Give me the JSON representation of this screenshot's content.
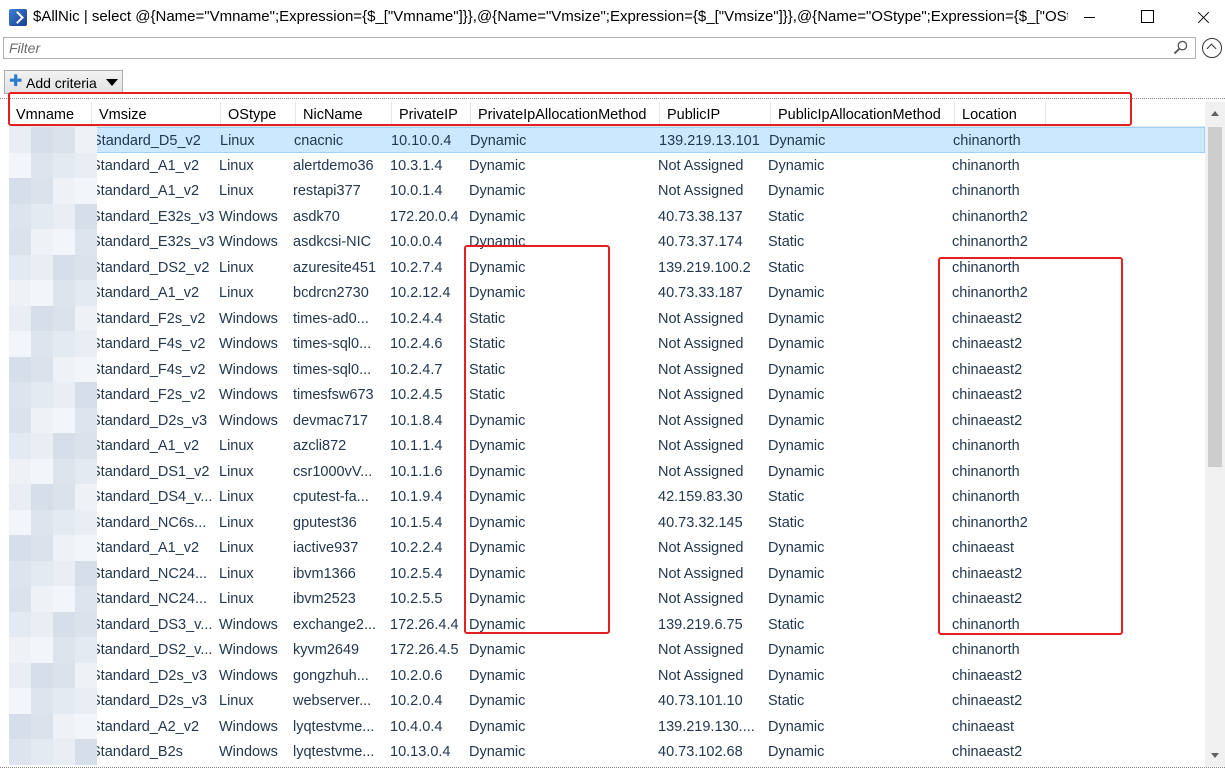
{
  "window": {
    "title": "$AllNic | select @{Name=\"Vmname\";Expression={$_[\"Vmname\"]}},@{Name=\"Vmsize\";Expression={$_[\"Vmsize\"]}},@{Name=\"OStype\";Expression={$_[\"OStype\"]}}..."
  },
  "filter": {
    "placeholder": "Filter"
  },
  "toolbar": {
    "add_criteria_label": "Add criteria"
  },
  "columns": [
    "Vmname",
    "Vmsize",
    "OStype",
    "NicName",
    "PrivateIP",
    "PrivateIpAllocationMethod",
    "PublicIP",
    "PublicIpAllocationMethod",
    "Location"
  ],
  "rows": [
    [
      "Standard_D5_v2",
      "Linux",
      "cnacnic",
      "10.10.0.4",
      "Dynamic",
      "139.219.13.101",
      "Dynamic",
      "chinanorth"
    ],
    [
      "Standard_A1_v2",
      "Linux",
      "alertdemo36",
      "10.3.1.4",
      "Dynamic",
      "Not Assigned",
      "Dynamic",
      "chinanorth"
    ],
    [
      "Standard_A1_v2",
      "Linux",
      "restapi377",
      "10.0.1.4",
      "Dynamic",
      "Not Assigned",
      "Dynamic",
      "chinanorth"
    ],
    [
      "Standard_E32s_v3",
      "Windows",
      "asdk70",
      "172.20.0.4",
      "Dynamic",
      "40.73.38.137",
      "Static",
      "chinanorth2"
    ],
    [
      "Standard_E32s_v3",
      "Windows",
      "asdkcsi-NIC",
      "10.0.0.4",
      "Dynamic",
      "40.73.37.174",
      "Static",
      "chinanorth2"
    ],
    [
      "Standard_DS2_v2",
      "Linux",
      "azuresite451",
      "10.2.7.4",
      "Dynamic",
      "139.219.100.2",
      "Static",
      "chinanorth"
    ],
    [
      "Standard_A1_v2",
      "Linux",
      "bcdrcn2730",
      "10.2.12.4",
      "Dynamic",
      "40.73.33.187",
      "Dynamic",
      "chinanorth2"
    ],
    [
      "Standard_F2s_v2",
      "Windows",
      "times-ad0...",
      "10.2.4.4",
      "Static",
      "Not Assigned",
      "Dynamic",
      "chinaeast2"
    ],
    [
      "Standard_F4s_v2",
      "Windows",
      "times-sql0...",
      "10.2.4.6",
      "Static",
      "Not Assigned",
      "Dynamic",
      "chinaeast2"
    ],
    [
      "Standard_F4s_v2",
      "Windows",
      "times-sql0...",
      "10.2.4.7",
      "Static",
      "Not Assigned",
      "Dynamic",
      "chinaeast2"
    ],
    [
      "Standard_F2s_v2",
      "Windows",
      "timesfsw673",
      "10.2.4.5",
      "Static",
      "Not Assigned",
      "Dynamic",
      "chinaeast2"
    ],
    [
      "Standard_D2s_v3",
      "Windows",
      "devmac717",
      "10.1.8.4",
      "Dynamic",
      "Not Assigned",
      "Dynamic",
      "chinaeast2"
    ],
    [
      "Standard_A1_v2",
      "Linux",
      "azcli872",
      "10.1.1.4",
      "Dynamic",
      "Not Assigned",
      "Dynamic",
      "chinanorth"
    ],
    [
      "Standard_DS1_v2",
      "Linux",
      "csr1000vV...",
      "10.1.1.6",
      "Dynamic",
      "Not Assigned",
      "Dynamic",
      "chinanorth"
    ],
    [
      "Standard_DS4_v...",
      "Linux",
      "cputest-fa...",
      "10.1.9.4",
      "Dynamic",
      "42.159.83.30",
      "Static",
      "chinanorth"
    ],
    [
      "Standard_NC6s...",
      "Linux",
      "gputest36",
      "10.1.5.4",
      "Dynamic",
      "40.73.32.145",
      "Static",
      "chinanorth2"
    ],
    [
      "Standard_A1_v2",
      "Linux",
      "iactive937",
      "10.2.2.4",
      "Dynamic",
      "Not Assigned",
      "Dynamic",
      "chinaeast"
    ],
    [
      "Standard_NC24...",
      "Linux",
      "ibvm1366",
      "10.2.5.4",
      "Dynamic",
      "Not Assigned",
      "Dynamic",
      "chinaeast2"
    ],
    [
      "Standard_NC24...",
      "Linux",
      "ibvm2523",
      "10.2.5.5",
      "Dynamic",
      "Not Assigned",
      "Dynamic",
      "chinaeast2"
    ],
    [
      "Standard_DS3_v...",
      "Windows",
      "exchange2...",
      "172.26.4.4",
      "Dynamic",
      "139.219.6.75",
      "Static",
      "chinanorth"
    ],
    [
      "Standard_DS2_v...",
      "Windows",
      "kyvm2649",
      "172.26.4.5",
      "Dynamic",
      "Not Assigned",
      "Dynamic",
      "chinanorth"
    ],
    [
      "Standard_D2s_v3",
      "Windows",
      "gongzhuh...",
      "10.2.0.6",
      "Dynamic",
      "Not Assigned",
      "Dynamic",
      "chinaeast2"
    ],
    [
      "Standard_D2s_v3",
      "Linux",
      "webserver...",
      "10.2.0.4",
      "Dynamic",
      "40.73.101.10",
      "Static",
      "chinaeast2"
    ],
    [
      "Standard_A2_v2",
      "Windows",
      "lyqtestvme...",
      "10.4.0.4",
      "Dynamic",
      "139.219.130....",
      "Dynamic",
      "chinaeast"
    ],
    [
      "Standard_B2s",
      "Windows",
      "lyqtestvme...",
      "10.13.0.4",
      "Dynamic",
      "40.73.102.68",
      "Dynamic",
      "chinaeast2"
    ]
  ],
  "colors": {
    "selection": "#cce8ff",
    "annotation": "#e41f1f",
    "cell_text": "#23384e"
  }
}
